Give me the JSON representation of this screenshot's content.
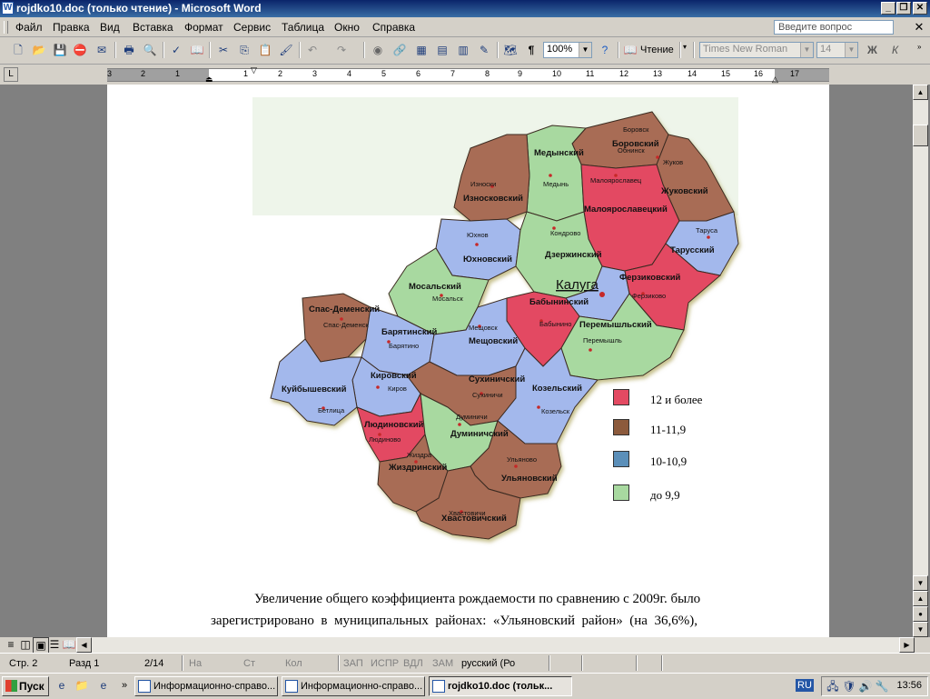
{
  "window": {
    "title": "rojdko10.doc (только чтение) - Microsoft Word"
  },
  "menu": {
    "items": [
      "Файл",
      "Правка",
      "Вид",
      "Вставка",
      "Формат",
      "Сервис",
      "Таблица",
      "Окно",
      "Справка"
    ],
    "ask_placeholder": "Введите вопрос"
  },
  "toolbar": {
    "zoom": "100%",
    "reading_label": "Чтение",
    "font": "Times New Roman",
    "font_size": "14",
    "bold": "Ж",
    "italic": "К"
  },
  "ruler": {
    "numbers": [
      "3",
      "2",
      "1",
      "1",
      "2",
      "3",
      "4",
      "5",
      "6",
      "7",
      "8",
      "9",
      "10",
      "11",
      "12",
      "13",
      "14",
      "15",
      "16",
      "17"
    ]
  },
  "map": {
    "city": "Калуга",
    "regions": [
      {
        "name": "Боровский",
        "town": "Боровск"
      },
      {
        "name": "Медынский",
        "town": "Медынь"
      },
      {
        "name": "Жуковский",
        "town": "Жуков"
      },
      {
        "name": "Малоярославецкий",
        "town": "Малоярославец"
      },
      {
        "name": "Износковский",
        "town": "Износки"
      },
      {
        "name": "Тарусский",
        "town": "Таруса"
      },
      {
        "name": "Юхновский",
        "town": "Юхнов"
      },
      {
        "name": "Дзержинский",
        "town": "Кондрово"
      },
      {
        "name": "Ферзиковский",
        "town": "Ферзиково"
      },
      {
        "name": "Мосальский",
        "town": "Мосальск"
      },
      {
        "name": "Бабынинский",
        "town": "Бабынино"
      },
      {
        "name": "Спас-Деменский",
        "town": "Спас-Деменск"
      },
      {
        "name": "Барятинский",
        "town": "Барятино"
      },
      {
        "name": "Мещовский",
        "town": "Мещовск"
      },
      {
        "name": "Перемышльский",
        "town": "Перемышль"
      },
      {
        "name": "Кировский",
        "town": "Киров"
      },
      {
        "name": "Куйбышевский",
        "town": "Бетлица"
      },
      {
        "name": "Сухиничский",
        "town": "Сухиничи"
      },
      {
        "name": "Козельский",
        "town": "Козельск"
      },
      {
        "name": "Людиновский",
        "town": "Людиново"
      },
      {
        "name": "Думиничский",
        "town": "Думиничи"
      },
      {
        "name": "Жиздринский",
        "town": "Жиздра"
      },
      {
        "name": "Ульяновский",
        "town": "Ульяново"
      },
      {
        "name": "Хвастовичский",
        "town": "Хвастовичи"
      }
    ],
    "other_labels": {
      "obninsk": "Обнинск"
    },
    "colors": {
      "red": "#e34a62",
      "brown": "#a86c55",
      "blue": "#a3b8ec",
      "green": "#a8d9a0"
    },
    "legend": [
      {
        "label": "12 и более",
        "color": "#e34a62"
      },
      {
        "label": "11-11,9",
        "color": "#8c5a3c"
      },
      {
        "label": "10-10,9",
        "color": "#5b8fb9"
      },
      {
        "label": "до 9,9",
        "color": "#a8d9a0"
      }
    ]
  },
  "document": {
    "line1": "Увеличение общего коэффициента рождаемости по сравнению с 2009г. было",
    "line2": "зарегистрировано  в  муниципальных  районах:  «Ульяновский  район»  (на  36,6%),"
  },
  "status": {
    "page": "Стр. 2",
    "section": "Разд 1",
    "pages": "2/14",
    "at": "На",
    "line": "Ст",
    "col": "Кол",
    "rec": "ЗАП",
    "trk": "ИСПР",
    "ext": "ВДЛ",
    "ovr": "ЗАМ",
    "lang": "русский (Ро"
  },
  "taskbar": {
    "start": "Пуск",
    "tasks": [
      "Информационно-справо...",
      "Информационно-справо...",
      "rojdko10.doc (тольк..."
    ],
    "lang": "RU",
    "clock": "13:56"
  }
}
